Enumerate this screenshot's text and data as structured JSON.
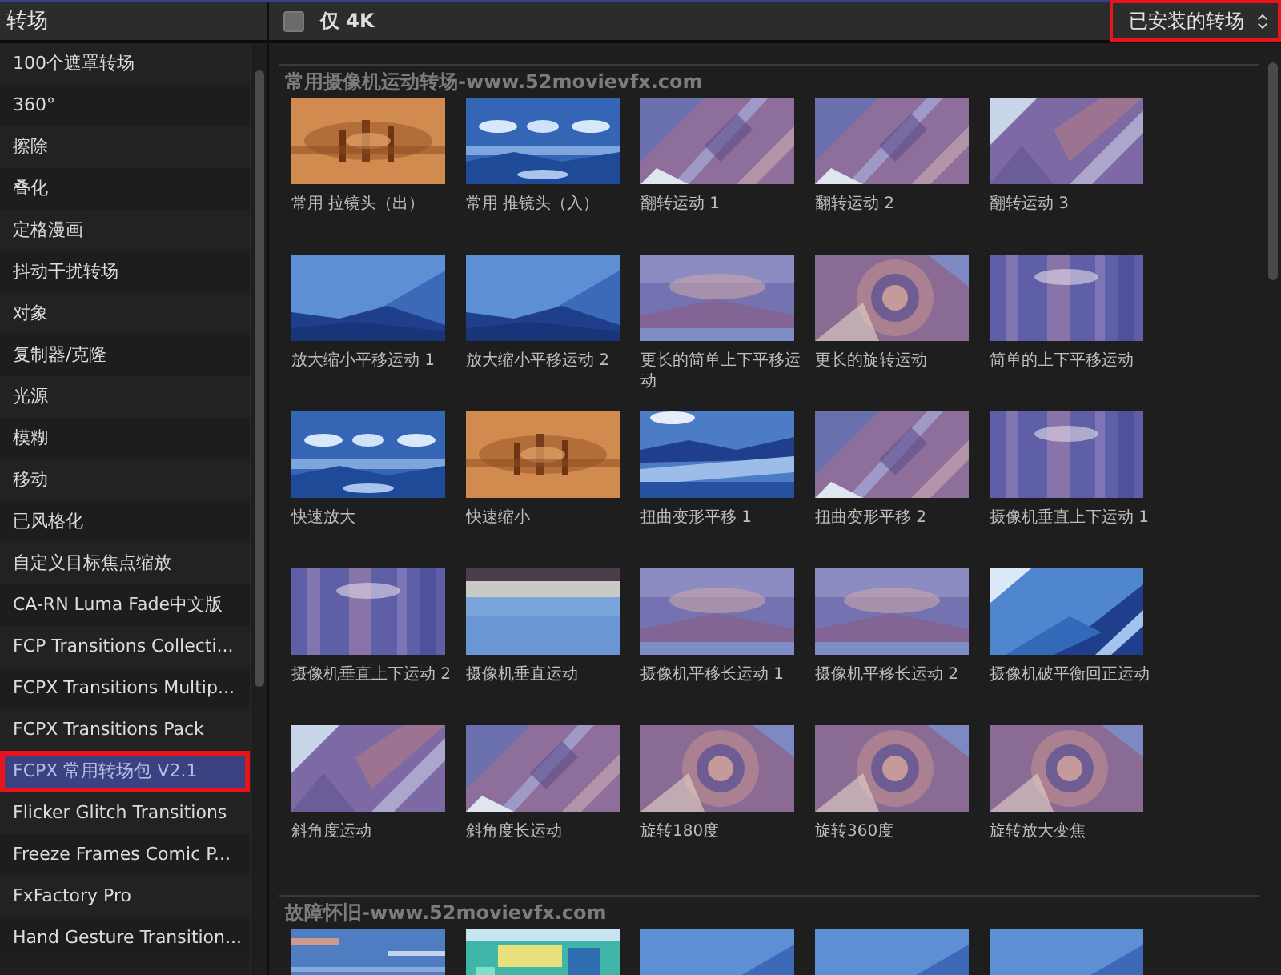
{
  "sidebar": {
    "title": "转场",
    "items": [
      {
        "label": "100个遮罩转场",
        "selected": false,
        "annotated": false
      },
      {
        "label": "360°",
        "selected": false,
        "annotated": false
      },
      {
        "label": "擦除",
        "selected": false,
        "annotated": false
      },
      {
        "label": "叠化",
        "selected": false,
        "annotated": false
      },
      {
        "label": "定格漫画",
        "selected": false,
        "annotated": false
      },
      {
        "label": "抖动干扰转场",
        "selected": false,
        "annotated": false
      },
      {
        "label": "对象",
        "selected": false,
        "annotated": false
      },
      {
        "label": "复制器/克隆",
        "selected": false,
        "annotated": false
      },
      {
        "label": "光源",
        "selected": false,
        "annotated": false
      },
      {
        "label": "模糊",
        "selected": false,
        "annotated": false
      },
      {
        "label": "移动",
        "selected": false,
        "annotated": false
      },
      {
        "label": "已风格化",
        "selected": false,
        "annotated": false
      },
      {
        "label": "自定义目标焦点缩放",
        "selected": false,
        "annotated": false
      },
      {
        "label": "CA-RN Luma Fade中文版",
        "selected": false,
        "annotated": false
      },
      {
        "label": "FCP Transitions Collecti...",
        "selected": false,
        "annotated": false
      },
      {
        "label": "FCPX Transitions Multip...",
        "selected": false,
        "annotated": false
      },
      {
        "label": "FCPX Transitions Pack",
        "selected": false,
        "annotated": false
      },
      {
        "label": "FCPX 常用转场包 V2.1",
        "selected": true,
        "annotated": true
      },
      {
        "label": "Flicker Glitch Transitions",
        "selected": false,
        "annotated": false
      },
      {
        "label": "Freeze Frames Comic P...",
        "selected": false,
        "annotated": false
      },
      {
        "label": "FxFactory Pro",
        "selected": false,
        "annotated": false
      },
      {
        "label": "Hand Gesture Transition...",
        "selected": false,
        "annotated": false
      }
    ]
  },
  "toolbar": {
    "only_4k": {
      "label": "仅 4K",
      "checked": false
    },
    "filter": {
      "value": "已安装的转场",
      "annotated": true
    }
  },
  "sections": [
    {
      "title": "常用摄像机运动转场-www.52movievfx.com",
      "items": [
        {
          "kind": "picture",
          "label": "常用 拉镜头（出）"
        },
        {
          "kind": "picture",
          "label": "常用 推镜头（入）"
        },
        {
          "kind": "picture",
          "label": "翻转运动 1"
        },
        {
          "kind": "picture",
          "label": "翻转运动 2"
        },
        {
          "kind": "picture",
          "label": "翻转运动 3"
        },
        {
          "kind": "picture",
          "label": "放大缩小平移运动 1"
        },
        {
          "kind": "picture",
          "label": "放大缩小平移运动 2"
        },
        {
          "kind": "picture",
          "label": "更长的简单上下平移运动"
        },
        {
          "kind": "picture",
          "label": "更长的旋转运动"
        },
        {
          "kind": "picture",
          "label": "简单的上下平移运动"
        },
        {
          "kind": "picture",
          "label": "快速放大"
        },
        {
          "kind": "picture",
          "label": "快速缩小"
        },
        {
          "kind": "picture",
          "label": "扭曲变形平移 1"
        },
        {
          "kind": "picture",
          "label": "扭曲变形平移 2"
        },
        {
          "kind": "picture",
          "label": "摄像机垂直上下运动 1"
        },
        {
          "kind": "picture",
          "label": "摄像机垂直上下运动 2"
        },
        {
          "kind": "picture",
          "label": "摄像机垂直运动"
        },
        {
          "kind": "picture",
          "label": "摄像机平移长运动 1"
        },
        {
          "kind": "picture",
          "label": "摄像机平移长运动 2"
        },
        {
          "kind": "picture",
          "label": "摄像机破平衡回正运动"
        },
        {
          "kind": "picture",
          "label": "斜角度运动"
        },
        {
          "kind": "picture",
          "label": "斜角度长运动"
        },
        {
          "kind": "picture",
          "label": "旋转180度"
        },
        {
          "kind": "picture",
          "label": "旋转360度"
        },
        {
          "kind": "picture",
          "label": "旋转放大变焦"
        }
      ]
    },
    {
      "title": "故障怀旧-www.52movievfx.com"
    }
  ]
}
